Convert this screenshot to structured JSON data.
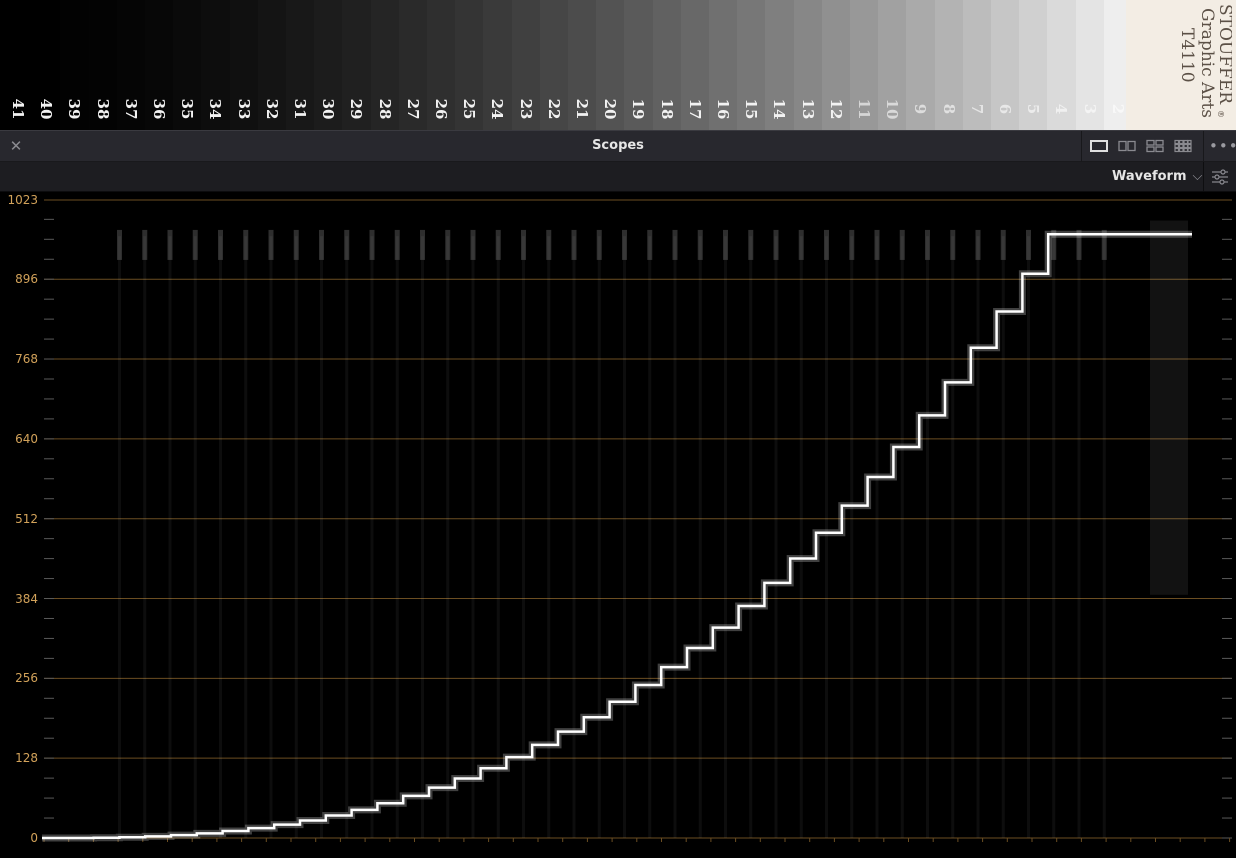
{
  "strip": {
    "step_numbers": [
      "41",
      "40",
      "39",
      "38",
      "37",
      "36",
      "35",
      "34",
      "33",
      "32",
      "31",
      "30",
      "29",
      "28",
      "27",
      "26",
      "25",
      "24",
      "23",
      "22",
      "21",
      "20",
      "19",
      "18",
      "17",
      "16",
      "15",
      "14",
      "13",
      "12",
      "11",
      "10",
      "9",
      "8",
      "7",
      "6",
      "5",
      "4",
      "3",
      "2"
    ],
    "brand_line1": "STOUFFER",
    "brand_mark": "®",
    "brand_line2": "Graphic Arts",
    "brand_line3": "T4110"
  },
  "header": {
    "title": "Scopes",
    "close_icon": "close-icon",
    "layout_icons": [
      "single-view-icon",
      "dual-view-icon",
      "quad-view-icon",
      "grid-view-icon"
    ],
    "more_icon": "more-options-icon"
  },
  "toolbar": {
    "mode": "Waveform",
    "mode_icon": "chevron-down-icon",
    "settings_icon": "sliders-settings-icon"
  },
  "scope": {
    "scale_labels": [
      "1023",
      "896",
      "768",
      "640",
      "512",
      "384",
      "256",
      "128",
      "0"
    ],
    "colors": {
      "graticule": "#6b4e22",
      "scale_text": "#d2a25a",
      "trace": "#ffffff"
    }
  }
}
